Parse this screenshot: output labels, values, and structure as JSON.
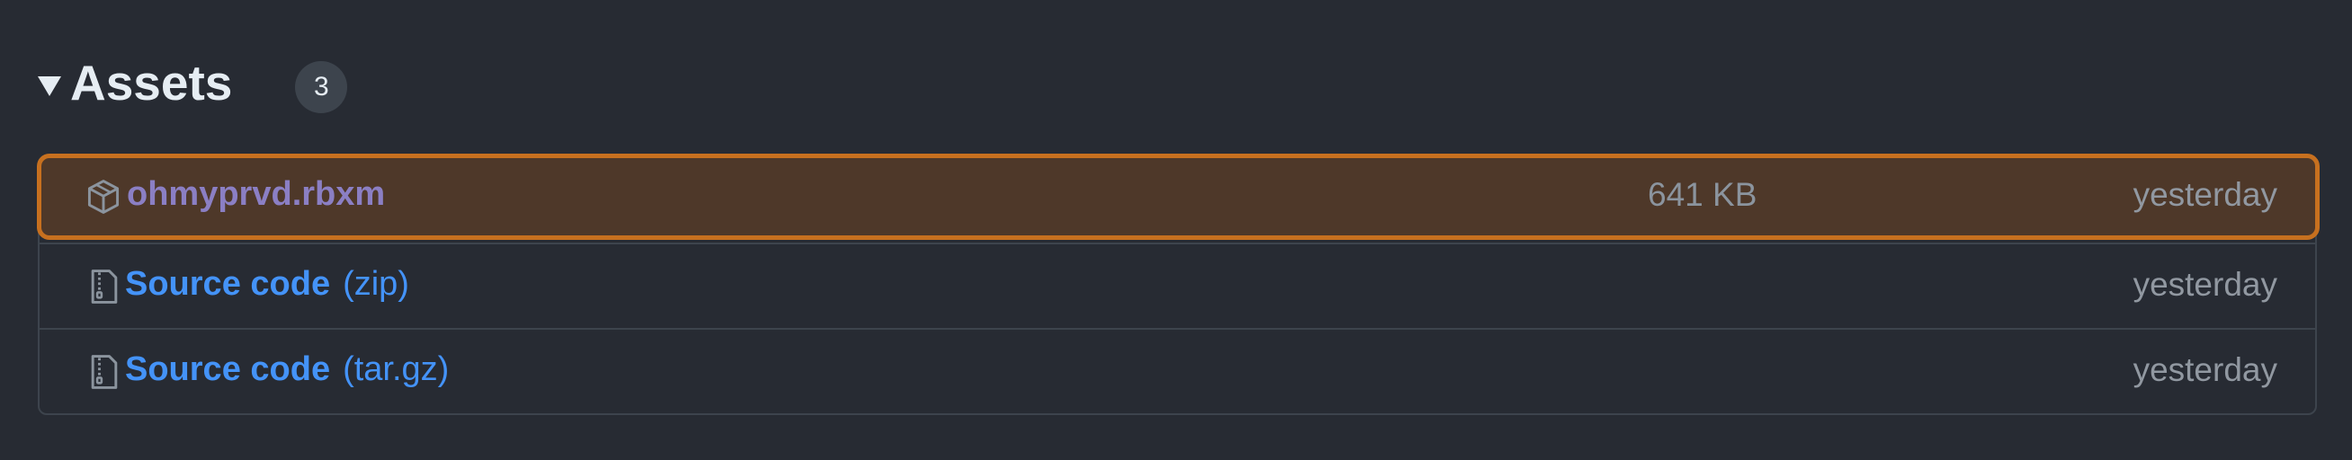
{
  "assets": {
    "title": "Assets",
    "count": "3",
    "items": [
      {
        "icon": "package-icon",
        "name": "ohmyprvd.rbxm",
        "suffix": "",
        "size": "641 KB",
        "date": "yesterday",
        "highlighted": true
      },
      {
        "icon": "file-zip-icon",
        "name": "Source code",
        "suffix": "(zip)",
        "size": "",
        "date": "yesterday",
        "highlighted": false
      },
      {
        "icon": "file-zip-icon",
        "name": "Source code",
        "suffix": "(tar.gz)",
        "size": "",
        "date": "yesterday",
        "highlighted": false
      }
    ]
  },
  "colors": {
    "background": "#272b33",
    "highlight_fill": "#4e3829",
    "highlight_border": "#c7701f",
    "link": "#4493f8",
    "visited_link": "#8b7fc4",
    "muted_text": "#9198a1"
  }
}
